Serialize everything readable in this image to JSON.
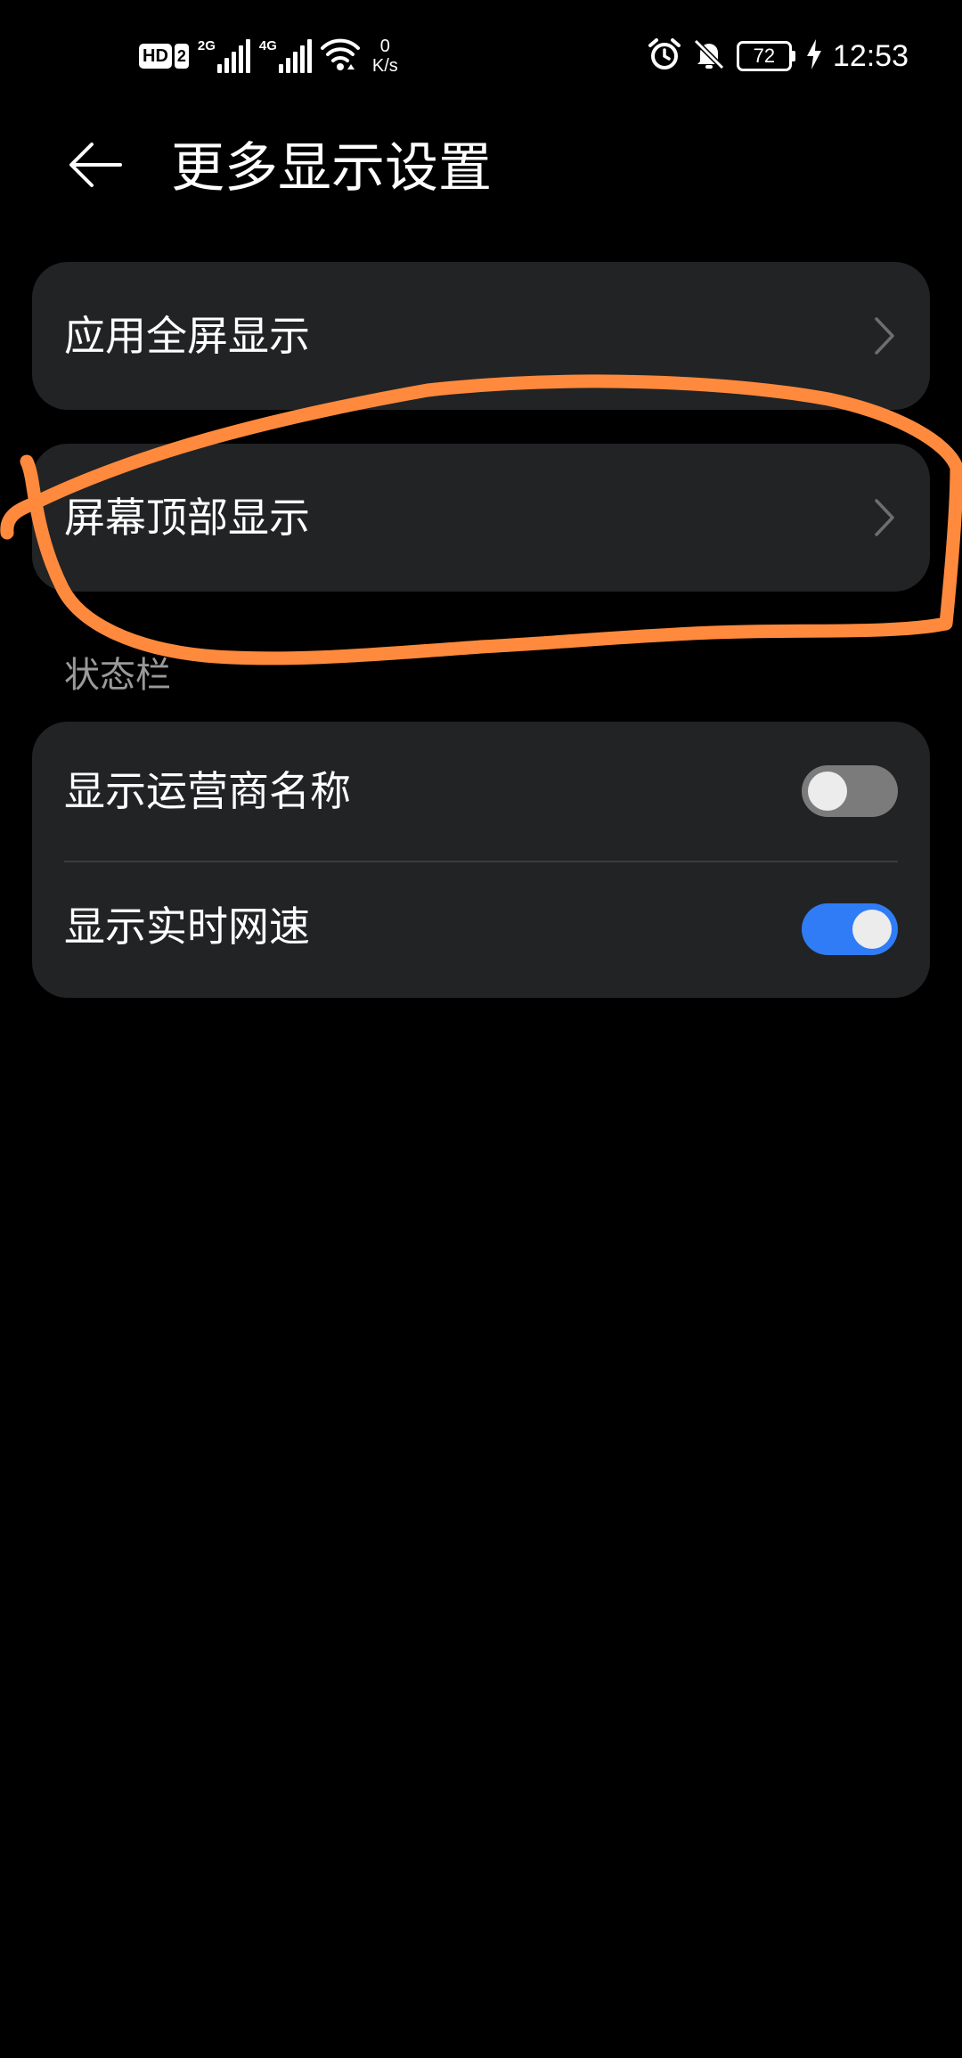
{
  "status_bar": {
    "hd_label": "HD",
    "sim_number": "2",
    "signal_1_gen": "2G",
    "signal_2_gen": "4G",
    "net_speed_value": "0",
    "net_speed_unit": "K/s",
    "battery_level": "72",
    "time": "12:53",
    "icons": [
      "wifi-icon",
      "alarm-icon",
      "notifications-off-icon",
      "battery-icon",
      "charging-icon"
    ]
  },
  "header": {
    "title": "更多显示设置",
    "back_icon": "arrow-left-icon"
  },
  "nav_items": [
    {
      "label": "应用全屏显示"
    },
    {
      "label": "屏幕顶部显示"
    }
  ],
  "status_section": {
    "label": "状态栏",
    "toggles": [
      {
        "label": "显示运营商名称",
        "enabled": false
      },
      {
        "label": "显示实时网速",
        "enabled": true
      }
    ]
  },
  "colors": {
    "background": "#000000",
    "card": "#222325",
    "toggle_on": "#2f7cf6",
    "toggle_off": "#7b7b7b",
    "annotation": "#ff8a3d"
  }
}
